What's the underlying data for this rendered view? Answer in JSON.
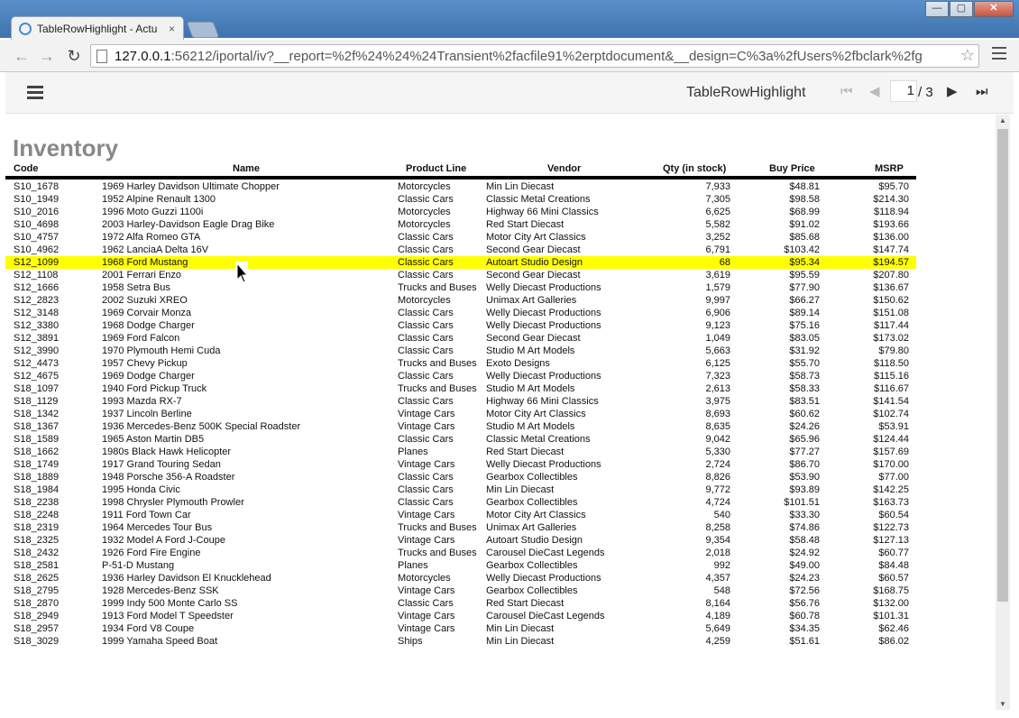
{
  "browser": {
    "tab_title": "TableRowHighlight - Actu",
    "tab_close": "×",
    "url_host": "127.0.0.1",
    "url_rest": ":56212/iportal/iv?__report=%2f%24%24%24Transient%2facfile91%2erptdocument&__design=C%3a%2fUsers%2fbclark%2fg",
    "back_icon": "←",
    "forward_icon": "→",
    "reload_icon": "↻",
    "star_icon": "☆",
    "window_buttons": {
      "minimize": "—",
      "maximize": "▢",
      "close": "✕"
    }
  },
  "app": {
    "report_name": "TableRowHighlight",
    "page_current": "1",
    "page_total": "/ 3",
    "first_icon": "⏮",
    "prev_icon": "◀",
    "next_icon": "▶",
    "last_icon": "⏭"
  },
  "report": {
    "title": "Inventory",
    "headers": {
      "code": "Code",
      "name": "Name",
      "line": "Product Line",
      "vendor": "Vendor",
      "qty": "Qty (in stock)",
      "buy": "Buy Price",
      "msrp": "MSRP"
    },
    "highlight_color": "#ffff00",
    "rows": [
      {
        "code": "S10_1678",
        "name": "1969 Harley Davidson Ultimate Chopper",
        "line": "Motorcycles",
        "vendor": "Min Lin Diecast",
        "qty": "7,933",
        "buy": "$48.81",
        "msrp": "$95.70"
      },
      {
        "code": "S10_1949",
        "name": "1952 Alpine Renault 1300",
        "line": "Classic Cars",
        "vendor": "Classic Metal Creations",
        "qty": "7,305",
        "buy": "$98.58",
        "msrp": "$214.30"
      },
      {
        "code": "S10_2016",
        "name": "1996 Moto Guzzi 1100i",
        "line": "Motorcycles",
        "vendor": "Highway 66 Mini Classics",
        "qty": "6,625",
        "buy": "$68.99",
        "msrp": "$118.94"
      },
      {
        "code": "S10_4698",
        "name": "2003 Harley-Davidson Eagle Drag Bike",
        "line": "Motorcycles",
        "vendor": "Red Start Diecast",
        "qty": "5,582",
        "buy": "$91.02",
        "msrp": "$193.66"
      },
      {
        "code": "S10_4757",
        "name": "1972 Alfa Romeo GTA",
        "line": "Classic Cars",
        "vendor": "Motor City Art Classics",
        "qty": "3,252",
        "buy": "$85.68",
        "msrp": "$136.00"
      },
      {
        "code": "S10_4962",
        "name": "1962 LanciaA Delta 16V",
        "line": "Classic Cars",
        "vendor": "Second Gear Diecast",
        "qty": "6,791",
        "buy": "$103.42",
        "msrp": "$147.74"
      },
      {
        "code": "S12_1099",
        "name": "1968 Ford Mustang",
        "line": "Classic Cars",
        "vendor": "Autoart Studio Design",
        "qty": "68",
        "buy": "$95.34",
        "msrp": "$194.57",
        "highlight": true
      },
      {
        "code": "S12_1108",
        "name": "2001 Ferrari Enzo",
        "line": "Classic Cars",
        "vendor": "Second Gear Diecast",
        "qty": "3,619",
        "buy": "$95.59",
        "msrp": "$207.80"
      },
      {
        "code": "S12_1666",
        "name": "1958 Setra Bus",
        "line": "Trucks and Buses",
        "vendor": "Welly Diecast Productions",
        "qty": "1,579",
        "buy": "$77.90",
        "msrp": "$136.67"
      },
      {
        "code": "S12_2823",
        "name": "2002 Suzuki XREO",
        "line": "Motorcycles",
        "vendor": "Unimax Art Galleries",
        "qty": "9,997",
        "buy": "$66.27",
        "msrp": "$150.62"
      },
      {
        "code": "S12_3148",
        "name": "1969 Corvair Monza",
        "line": "Classic Cars",
        "vendor": "Welly Diecast Productions",
        "qty": "6,906",
        "buy": "$89.14",
        "msrp": "$151.08"
      },
      {
        "code": "S12_3380",
        "name": "1968 Dodge Charger",
        "line": "Classic Cars",
        "vendor": "Welly Diecast Productions",
        "qty": "9,123",
        "buy": "$75.16",
        "msrp": "$117.44"
      },
      {
        "code": "S12_3891",
        "name": "1969 Ford Falcon",
        "line": "Classic Cars",
        "vendor": "Second Gear Diecast",
        "qty": "1,049",
        "buy": "$83.05",
        "msrp": "$173.02"
      },
      {
        "code": "S12_3990",
        "name": "1970 Plymouth Hemi Cuda",
        "line": "Classic Cars",
        "vendor": "Studio M Art Models",
        "qty": "5,663",
        "buy": "$31.92",
        "msrp": "$79.80"
      },
      {
        "code": "S12_4473",
        "name": "1957 Chevy Pickup",
        "line": "Trucks and Buses",
        "vendor": "Exoto Designs",
        "qty": "6,125",
        "buy": "$55.70",
        "msrp": "$118.50"
      },
      {
        "code": "S12_4675",
        "name": "1969 Dodge Charger",
        "line": "Classic Cars",
        "vendor": "Welly Diecast Productions",
        "qty": "7,323",
        "buy": "$58.73",
        "msrp": "$115.16"
      },
      {
        "code": "S18_1097",
        "name": "1940 Ford Pickup Truck",
        "line": "Trucks and Buses",
        "vendor": "Studio M Art Models",
        "qty": "2,613",
        "buy": "$58.33",
        "msrp": "$116.67"
      },
      {
        "code": "S18_1129",
        "name": "1993 Mazda RX-7",
        "line": "Classic Cars",
        "vendor": "Highway 66 Mini Classics",
        "qty": "3,975",
        "buy": "$83.51",
        "msrp": "$141.54"
      },
      {
        "code": "S18_1342",
        "name": "1937 Lincoln Berline",
        "line": "Vintage Cars",
        "vendor": "Motor City Art Classics",
        "qty": "8,693",
        "buy": "$60.62",
        "msrp": "$102.74"
      },
      {
        "code": "S18_1367",
        "name": "1936 Mercedes-Benz 500K Special Roadster",
        "line": "Vintage Cars",
        "vendor": "Studio M Art Models",
        "qty": "8,635",
        "buy": "$24.26",
        "msrp": "$53.91"
      },
      {
        "code": "S18_1589",
        "name": "1965 Aston Martin DB5",
        "line": "Classic Cars",
        "vendor": "Classic Metal Creations",
        "qty": "9,042",
        "buy": "$65.96",
        "msrp": "$124.44"
      },
      {
        "code": "S18_1662",
        "name": "1980s Black Hawk Helicopter",
        "line": "Planes",
        "vendor": "Red Start Diecast",
        "qty": "5,330",
        "buy": "$77.27",
        "msrp": "$157.69"
      },
      {
        "code": "S18_1749",
        "name": "1917 Grand Touring Sedan",
        "line": "Vintage Cars",
        "vendor": "Welly Diecast Productions",
        "qty": "2,724",
        "buy": "$86.70",
        "msrp": "$170.00"
      },
      {
        "code": "S18_1889",
        "name": "1948 Porsche 356-A Roadster",
        "line": "Classic Cars",
        "vendor": "Gearbox Collectibles",
        "qty": "8,826",
        "buy": "$53.90",
        "msrp": "$77.00"
      },
      {
        "code": "S18_1984",
        "name": "1995 Honda Civic",
        "line": "Classic Cars",
        "vendor": "Min Lin Diecast",
        "qty": "9,772",
        "buy": "$93.89",
        "msrp": "$142.25"
      },
      {
        "code": "S18_2238",
        "name": "1998 Chrysler Plymouth Prowler",
        "line": "Classic Cars",
        "vendor": "Gearbox Collectibles",
        "qty": "4,724",
        "buy": "$101.51",
        "msrp": "$163.73"
      },
      {
        "code": "S18_2248",
        "name": "1911 Ford Town Car",
        "line": "Vintage Cars",
        "vendor": "Motor City Art Classics",
        "qty": "540",
        "buy": "$33.30",
        "msrp": "$60.54"
      },
      {
        "code": "S18_2319",
        "name": "1964 Mercedes Tour Bus",
        "line": "Trucks and Buses",
        "vendor": "Unimax Art Galleries",
        "qty": "8,258",
        "buy": "$74.86",
        "msrp": "$122.73"
      },
      {
        "code": "S18_2325",
        "name": "1932 Model A Ford J-Coupe",
        "line": "Vintage Cars",
        "vendor": "Autoart Studio Design",
        "qty": "9,354",
        "buy": "$58.48",
        "msrp": "$127.13"
      },
      {
        "code": "S18_2432",
        "name": "1926 Ford Fire Engine",
        "line": "Trucks and Buses",
        "vendor": "Carousel DieCast Legends",
        "qty": "2,018",
        "buy": "$24.92",
        "msrp": "$60.77"
      },
      {
        "code": "S18_2581",
        "name": "P-51-D Mustang",
        "line": "Planes",
        "vendor": "Gearbox Collectibles",
        "qty": "992",
        "buy": "$49.00",
        "msrp": "$84.48"
      },
      {
        "code": "S18_2625",
        "name": "1936 Harley Davidson El Knucklehead",
        "line": "Motorcycles",
        "vendor": "Welly Diecast Productions",
        "qty": "4,357",
        "buy": "$24.23",
        "msrp": "$60.57"
      },
      {
        "code": "S18_2795",
        "name": "1928 Mercedes-Benz SSK",
        "line": "Vintage Cars",
        "vendor": "Gearbox Collectibles",
        "qty": "548",
        "buy": "$72.56",
        "msrp": "$168.75"
      },
      {
        "code": "S18_2870",
        "name": "1999 Indy 500 Monte Carlo SS",
        "line": "Classic Cars",
        "vendor": "Red Start Diecast",
        "qty": "8,164",
        "buy": "$56.76",
        "msrp": "$132.00"
      },
      {
        "code": "S18_2949",
        "name": "1913 Ford Model T Speedster",
        "line": "Vintage Cars",
        "vendor": "Carousel DieCast Legends",
        "qty": "4,189",
        "buy": "$60.78",
        "msrp": "$101.31"
      },
      {
        "code": "S18_2957",
        "name": "1934 Ford V8 Coupe",
        "line": "Vintage Cars",
        "vendor": "Min Lin Diecast",
        "qty": "5,649",
        "buy": "$34.35",
        "msrp": "$62.46"
      },
      {
        "code": "S18_3029",
        "name": "1999 Yamaha Speed Boat",
        "line": "Ships",
        "vendor": "Min Lin Diecast",
        "qty": "4,259",
        "buy": "$51.61",
        "msrp": "$86.02"
      }
    ]
  }
}
